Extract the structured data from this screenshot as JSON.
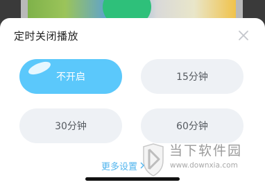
{
  "background": {
    "description_colors": {
      "thumb_left": "#7fb24a",
      "thumb_mid": "#5aa0d8",
      "thumb_right": "#f0c24a",
      "play_disc": "#2ec07a"
    }
  },
  "sheet": {
    "title": "定时关闭播放",
    "close_icon": "close-icon",
    "options": [
      {
        "label": "不开启",
        "selected": true
      },
      {
        "label": "15分钟",
        "selected": false
      },
      {
        "label": "30分钟",
        "selected": false
      },
      {
        "label": "60分钟",
        "selected": false
      }
    ],
    "more_link": "更多设置",
    "more_icon": "chevron-right-icon"
  },
  "watermark": {
    "name": "当下软件园",
    "url": "www.downxia.com"
  },
  "colors": {
    "accent": "#5bc8fb",
    "option_bg": "#eef1f5",
    "link": "#52b5ee",
    "title_text": "#222222"
  }
}
